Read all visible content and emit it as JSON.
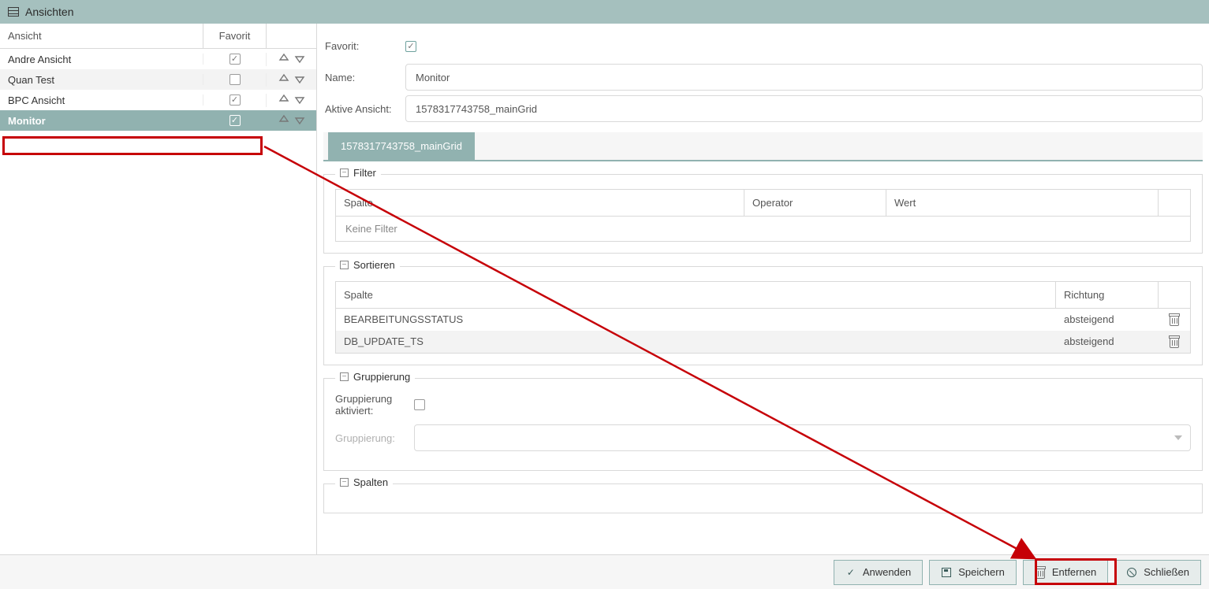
{
  "title": "Ansichten",
  "list": {
    "headers": {
      "name": "Ansicht",
      "fav": "Favorit"
    },
    "rows": [
      {
        "name": "Andre Ansicht",
        "fav": true,
        "selected": false
      },
      {
        "name": "Quan Test",
        "fav": false,
        "selected": false
      },
      {
        "name": "BPC Ansicht",
        "fav": true,
        "selected": false
      },
      {
        "name": "Monitor",
        "fav": true,
        "selected": true
      }
    ]
  },
  "detail": {
    "labels": {
      "fav": "Favorit:",
      "name": "Name:",
      "active": "Aktive Ansicht:"
    },
    "fav": true,
    "name": "Monitor",
    "activeView": "1578317743758_mainGrid",
    "tab": "1578317743758_mainGrid"
  },
  "filter": {
    "legend": "Filter",
    "headers": {
      "col": "Spalte",
      "op": "Operator",
      "val": "Wert"
    },
    "empty": "Keine Filter"
  },
  "sort": {
    "legend": "Sortieren",
    "headers": {
      "col": "Spalte",
      "dir": "Richtung"
    },
    "rows": [
      {
        "col": "BEARBEITUNGSSTATUS",
        "dir": "absteigend"
      },
      {
        "col": "DB_UPDATE_TS",
        "dir": "absteigend"
      }
    ]
  },
  "group": {
    "legend": "Gruppierung",
    "activeLabel": "Gruppierung aktiviert:",
    "active": false,
    "fieldLabel": "Gruppierung:"
  },
  "columns": {
    "legend": "Spalten"
  },
  "footer": {
    "apply": "Anwenden",
    "save": "Speichern",
    "remove": "Entfernen",
    "close": "Schließen"
  }
}
